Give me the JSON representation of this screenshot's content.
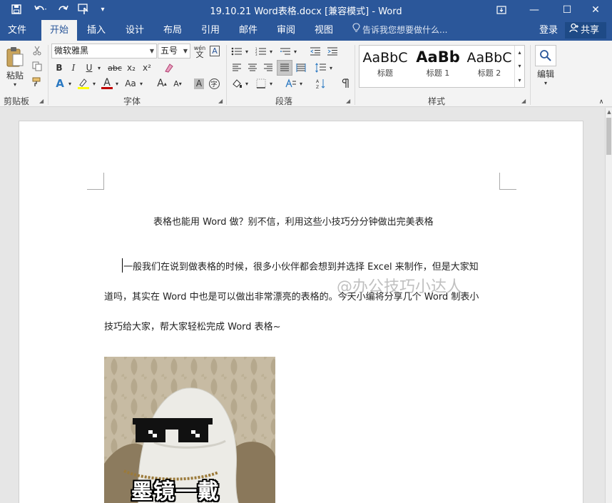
{
  "titlebar": {
    "title": "19.10.21 Word表格.docx [兼容模式] - Word",
    "restore_icon": "ribbon-display-icon",
    "minimize_glyph": "—",
    "maximize_glyph": "☐",
    "close_glyph": "✕"
  },
  "tabs": [
    {
      "id": "file",
      "label": "文件"
    },
    {
      "id": "home",
      "label": "开始"
    },
    {
      "id": "insert",
      "label": "插入"
    },
    {
      "id": "design",
      "label": "设计"
    },
    {
      "id": "layout",
      "label": "布局"
    },
    {
      "id": "references",
      "label": "引用"
    },
    {
      "id": "mailings",
      "label": "邮件"
    },
    {
      "id": "review",
      "label": "审阅"
    },
    {
      "id": "view",
      "label": "视图"
    }
  ],
  "tellme": "告诉我您想要做什么...",
  "login": "登录",
  "share": "共享",
  "ribbon": {
    "clipboard": {
      "paste_label": "粘贴",
      "group_label": "剪贴板"
    },
    "font": {
      "font_name": "微软雅黑",
      "font_size": "五号",
      "group_label": "字体",
      "bold": "B",
      "italic": "I",
      "underline": "U",
      "strike": "abc",
      "subscript": "x₂",
      "superscript": "x²",
      "phonetic": "wén",
      "change_case": "Aa",
      "grow": "A",
      "shrink": "A",
      "border_char": "A",
      "enclose_char": "字"
    },
    "paragraph": {
      "group_label": "段落"
    },
    "styles": {
      "group_label": "样式",
      "items": [
        {
          "sample": "AaBbC",
          "name": "标题"
        },
        {
          "sample": "AaBb",
          "name": "标题 1"
        },
        {
          "sample": "AaBbC",
          "name": "标题 2"
        }
      ]
    },
    "editing": {
      "label": "编辑"
    }
  },
  "document": {
    "title": "表格也能用 Word 做？别不信，利用这些小技巧分分钟做出完美表格",
    "lines": [
      "一般我们在说到做表格的时候，很多小伙伴都会想到并选择 Excel 来制作，但是大家知",
      "道吗，其实在 Word 中也是可以做出非常漂亮的表格的。今天小编将分享几个 Word 制表小",
      "技巧给大家，帮大家轻松完成 Word 表格~"
    ],
    "watermark": "@办公技巧小达人",
    "image_caption": "墨镜一戴"
  }
}
